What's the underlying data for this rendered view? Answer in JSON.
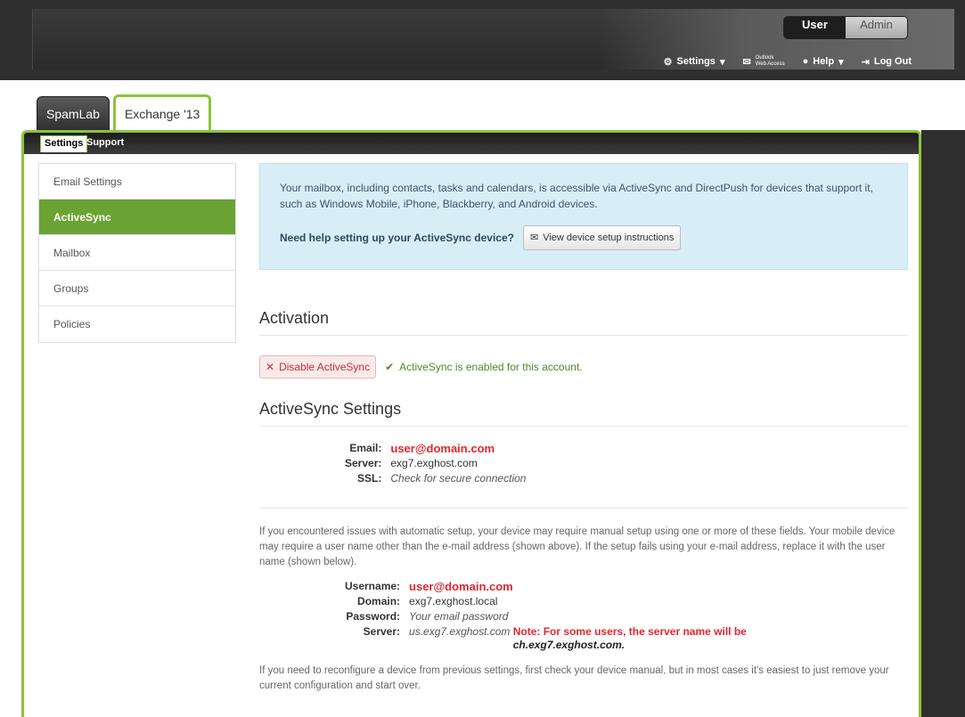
{
  "header": {
    "role_user": "User",
    "role_admin": "Admin",
    "nav": {
      "settings": "Settings",
      "owa_line1": "Outlook",
      "owa_line2": "Web Access",
      "help": "Help",
      "logout": "Log Out"
    }
  },
  "tabs": {
    "spamlab": "SpamLab",
    "exchange": "Exchange '13"
  },
  "subtabs": {
    "settings": "Settings",
    "support": "Support"
  },
  "watermark": "User",
  "sidebar": {
    "items": [
      {
        "label": "Email Settings"
      },
      {
        "label": "ActiveSync"
      },
      {
        "label": "Mailbox"
      },
      {
        "label": "Groups"
      },
      {
        "label": "Policies"
      }
    ]
  },
  "info": {
    "text": "Your mailbox, including contacts, tasks and calendars, is accessible via ActiveSync and DirectPush for devices that support it, such as Windows Mobile, iPhone, Blackberry, and Android devices.",
    "help_prompt": "Need help setting up your ActiveSync device?",
    "help_button": "View device setup instructions"
  },
  "activation": {
    "title": "Activation",
    "disable_button": "Disable ActiveSync",
    "status": "ActiveSync is enabled for this account."
  },
  "settings": {
    "title": "ActiveSync Settings",
    "email_label": "Email:",
    "email_value": "user@domain.com",
    "server_label": "Server:",
    "server_value": "exg7.exghost.com",
    "ssl_label": "SSL:",
    "ssl_value": "Check for secure connection",
    "manual_text": "If you encountered issues with automatic setup, your device may require manual setup using one or more of these fields. Your mobile device may require a user name other than the e-mail address (shown above). If the setup fails using your e-mail address, replace it with the user name (shown below).",
    "username_label": "Username:",
    "username_value": "user@domain.com",
    "domain_label": "Domain:",
    "domain_value": "exg7.exghost.local",
    "password_label": "Password:",
    "password_value": "Your email password",
    "server2_label": "Server:",
    "server2_value": "us.exg7.exghost.com",
    "note": "Note: For some users, the server name will be",
    "note_server": "ch.exg7.exghost.com.",
    "reconfigure_text": "If you need to reconfigure a device from previous settings, first check your device manual, but in most cases it's easiest to just remove your current configuration and start over."
  }
}
